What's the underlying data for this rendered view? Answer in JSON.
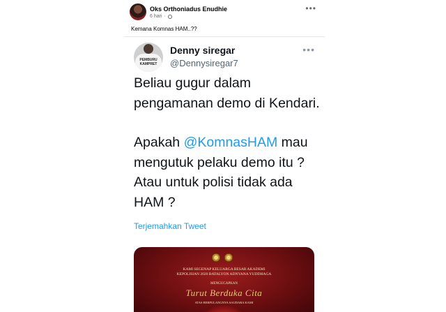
{
  "post": {
    "author": "Oks Orthoniadus Enudhie",
    "time": "6 hari",
    "more": "•••",
    "caption": "Kemana Komnas HAM..??"
  },
  "tweet": {
    "display_name": "Denny siregar",
    "handle": "@Dennysiregar7",
    "more": "•••",
    "avatar_shirt_text": "PEMBURU KAMPRET",
    "line1": "Beliau gugur dalam pengamanan demo di Kendari.",
    "line2_before": "Apakah ",
    "mention": "@KomnasHAM",
    "line2_after": " mau mengutuk pelaku demo itu ? Atau untuk polisi tidak ada HAM ?",
    "translate": "Terjemahkan Tweet",
    "mention_color": "#1d9bf0"
  },
  "card": {
    "l1": "KAMI SEGENAP KELUARGA BESAR AKADEMI",
    "l2": "KEPOLISIAN 2020 BATALYON ADNYANA YUDDHAGA",
    "l3": "MENGUCAPKAN",
    "script": "Turut Berduka Cita",
    "l4": "ATAS BERPULANGNYA SAUDARA KAMI"
  }
}
